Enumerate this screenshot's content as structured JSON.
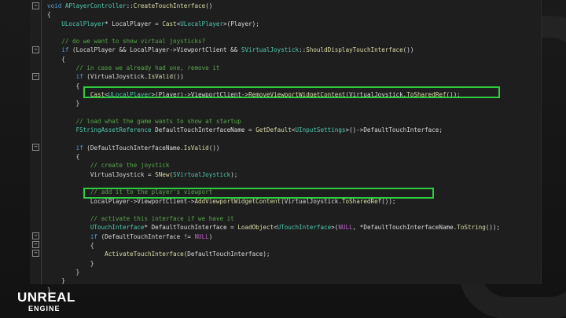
{
  "code": {
    "lines": [
      [
        {
          "t": "void ",
          "c": "kw"
        },
        {
          "t": "APlayerController",
          "c": "ty"
        },
        {
          "t": "::",
          "c": "va"
        },
        {
          "t": "CreateTouchInterface",
          "c": "fn"
        },
        {
          "t": "()",
          "c": "va"
        }
      ],
      [
        {
          "t": "{",
          "c": "va"
        }
      ],
      [
        {
          "t": "    ULocalPlayer",
          "c": "ty"
        },
        {
          "t": "* LocalPlayer = ",
          "c": "va"
        },
        {
          "t": "Cast",
          "c": "fn"
        },
        {
          "t": "<",
          "c": "va"
        },
        {
          "t": "ULocalPlayer",
          "c": "ty"
        },
        {
          "t": ">(Player);",
          "c": "va"
        }
      ],
      [],
      [
        {
          "t": "    // do we want to show virtual joysticks?",
          "c": "cm"
        }
      ],
      [
        {
          "t": "    if ",
          "c": "kw"
        },
        {
          "t": "(LocalPlayer && LocalPlayer->ViewportClient && ",
          "c": "va"
        },
        {
          "t": "SVirtualJoystick",
          "c": "ty"
        },
        {
          "t": "::",
          "c": "va"
        },
        {
          "t": "ShouldDisplayTouchInterface",
          "c": "fn"
        },
        {
          "t": "())",
          "c": "va"
        }
      ],
      [
        {
          "t": "    {",
          "c": "va"
        }
      ],
      [
        {
          "t": "        // in case we already had one, remove it",
          "c": "cm"
        }
      ],
      [
        {
          "t": "        if ",
          "c": "kw"
        },
        {
          "t": "(VirtualJoystick.",
          "c": "va"
        },
        {
          "t": "IsValid",
          "c": "fn"
        },
        {
          "t": "())",
          "c": "va"
        }
      ],
      [
        {
          "t": "        {",
          "c": "va"
        }
      ],
      [
        {
          "t": "            Cast",
          "c": "fn"
        },
        {
          "t": "<",
          "c": "va"
        },
        {
          "t": "ULocalPlayer",
          "c": "ty"
        },
        {
          "t": ">(Player)->ViewportClient->",
          "c": "va"
        },
        {
          "t": "RemoveViewportWidgetContent",
          "c": "fn"
        },
        {
          "t": "(VirtualJoystick.",
          "c": "va"
        },
        {
          "t": "ToSharedRef",
          "c": "fn"
        },
        {
          "t": "());",
          "c": "va"
        }
      ],
      [
        {
          "t": "        }",
          "c": "va"
        }
      ],
      [],
      [
        {
          "t": "        // load what the game wants to show at startup",
          "c": "cm"
        }
      ],
      [
        {
          "t": "        FStringAssetReference",
          "c": "ty"
        },
        {
          "t": " DefaultTouchInterfaceName = ",
          "c": "va"
        },
        {
          "t": "GetDefault",
          "c": "fn"
        },
        {
          "t": "<",
          "c": "va"
        },
        {
          "t": "UInputSettings",
          "c": "ty"
        },
        {
          "t": ">()->DefaultTouchInterface;",
          "c": "va"
        }
      ],
      [],
      [
        {
          "t": "        if ",
          "c": "kw"
        },
        {
          "t": "(DefaultTouchInterfaceName.",
          "c": "va"
        },
        {
          "t": "IsValid",
          "c": "fn"
        },
        {
          "t": "())",
          "c": "va"
        }
      ],
      [
        {
          "t": "        {",
          "c": "va"
        }
      ],
      [
        {
          "t": "            // create the joystick",
          "c": "cm"
        }
      ],
      [
        {
          "t": "            VirtualJoystick = ",
          "c": "va"
        },
        {
          "t": "SNew",
          "c": "fn"
        },
        {
          "t": "(",
          "c": "va"
        },
        {
          "t": "SVirtualJoystick",
          "c": "ty"
        },
        {
          "t": ");",
          "c": "va"
        }
      ],
      [],
      [
        {
          "t": "            // add it to the player's viewport",
          "c": "cm"
        }
      ],
      [
        {
          "t": "            LocalPlayer->ViewportClient->",
          "c": "va"
        },
        {
          "t": "AddViewportWidgetContent",
          "c": "fn"
        },
        {
          "t": "(VirtualJoystick.",
          "c": "va"
        },
        {
          "t": "ToSharedRef",
          "c": "fn"
        },
        {
          "t": "());",
          "c": "va"
        }
      ],
      [],
      [
        {
          "t": "            // activate this interface if we have it",
          "c": "cm"
        }
      ],
      [
        {
          "t": "            UTouchInterface",
          "c": "ty"
        },
        {
          "t": "* DefaultTouchInterface = ",
          "c": "va"
        },
        {
          "t": "LoadObject",
          "c": "fn"
        },
        {
          "t": "<",
          "c": "va"
        },
        {
          "t": "UTouchInterface",
          "c": "ty"
        },
        {
          "t": ">(",
          "c": "va"
        },
        {
          "t": "NULL",
          "c": "mc"
        },
        {
          "t": ", *DefaultTouchInterfaceName.",
          "c": "va"
        },
        {
          "t": "ToString",
          "c": "fn"
        },
        {
          "t": "());",
          "c": "va"
        }
      ],
      [
        {
          "t": "            if ",
          "c": "kw"
        },
        {
          "t": "(DefaultTouchInterface != ",
          "c": "va"
        },
        {
          "t": "NULL",
          "c": "mc"
        },
        {
          "t": ")",
          "c": "va"
        }
      ],
      [
        {
          "t": "            {",
          "c": "va"
        }
      ],
      [
        {
          "t": "                ActivateTouchInterface",
          "c": "fn"
        },
        {
          "t": "(DefaultTouchInterface);",
          "c": "va"
        }
      ],
      [
        {
          "t": "            }",
          "c": "va"
        }
      ],
      [
        {
          "t": "        }",
          "c": "va"
        }
      ],
      [
        {
          "t": "    }",
          "c": "va"
        }
      ],
      [
        {
          "t": "}",
          "c": "va"
        }
      ]
    ]
  },
  "folds": [
    "−",
    "−",
    "−",
    "−",
    "−",
    "−",
    "−"
  ],
  "brand": {
    "line1": "UNREAL",
    "line2": "ENGINE"
  },
  "colors": {
    "highlight": "#2ecc40",
    "comment": "#57a64a",
    "keyword": "#569cd6",
    "type": "#4ec9b0",
    "function": "#dcdcaa"
  }
}
